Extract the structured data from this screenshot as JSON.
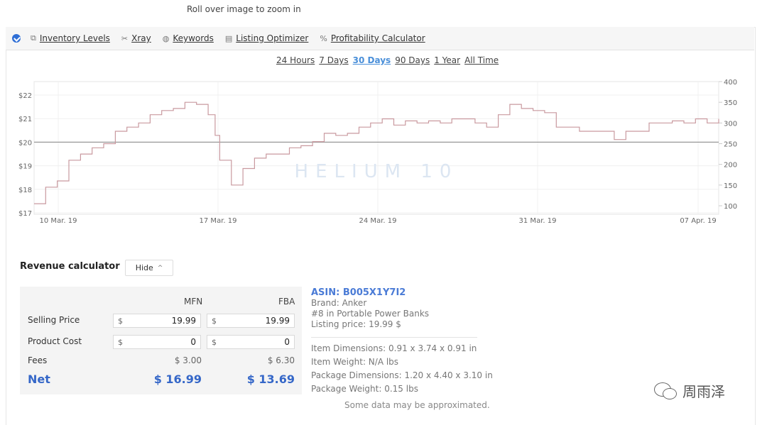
{
  "zoom_hint": "Roll over image to zoom in",
  "toolbar": {
    "items": [
      {
        "icon": "boxes-icon",
        "glyph": "⧉",
        "label": "Inventory Levels"
      },
      {
        "icon": "xray-icon",
        "glyph": "✂",
        "label": "Xray"
      },
      {
        "icon": "keywords-icon",
        "glyph": "◍",
        "label": "Keywords"
      },
      {
        "icon": "listing-icon",
        "glyph": "▤",
        "label": "Listing Optimizer"
      },
      {
        "icon": "percent-icon",
        "glyph": "%",
        "label": "Profitability Calculator"
      }
    ]
  },
  "time_ranges": {
    "options": [
      "24 Hours",
      "7 Days",
      "30 Days",
      "90 Days",
      "1 Year",
      "All Time"
    ],
    "active": "30 Days"
  },
  "chart_data": {
    "type": "line",
    "x_labels": [
      "10 Mar. 19",
      "17 Mar. 19",
      "24 Mar. 19",
      "31 Mar. 19",
      "07 Apr. 19"
    ],
    "y_left_ticks": [
      "$22",
      "$21",
      "$20",
      "$19",
      "$18",
      "$17"
    ],
    "y_right_ticks": [
      "400",
      "350",
      "300",
      "250",
      "200",
      "150",
      "100"
    ],
    "y_left_range": [
      17,
      22
    ],
    "y_right_range": [
      100,
      400
    ],
    "reference_line": 20,
    "series": [
      {
        "axis": "right",
        "color": "#c9999f",
        "x": [
          0,
          0.5,
          1,
          1.5,
          2,
          2.5,
          3,
          3.5,
          4,
          4.5,
          5,
          5.5,
          6,
          6.5,
          7,
          7.5,
          7.8,
          8,
          8.5,
          9,
          9.5,
          10,
          10.5,
          11,
          11.5,
          12,
          12.5,
          13,
          13.5,
          14,
          14.5,
          15,
          15.5,
          16,
          16.5,
          17,
          17.5,
          18,
          18.5,
          19,
          19.5,
          20,
          20.5,
          21,
          21.5,
          22,
          22.5,
          23,
          23.5,
          24,
          24.5,
          25,
          25.5,
          26,
          26.5,
          27,
          27.5,
          28,
          28.5,
          29,
          29.5
        ],
        "values": [
          105,
          145,
          160,
          210,
          225,
          240,
          250,
          280,
          290,
          300,
          320,
          330,
          335,
          350,
          345,
          320,
          270,
          210,
          150,
          190,
          215,
          225,
          225,
          240,
          245,
          255,
          275,
          270,
          275,
          290,
          300,
          310,
          295,
          305,
          300,
          305,
          300,
          310,
          310,
          300,
          290,
          320,
          345,
          335,
          330,
          325,
          290,
          290,
          280,
          280,
          280,
          260,
          280,
          280,
          300,
          300,
          305,
          300,
          310,
          300,
          310
        ]
      }
    ]
  },
  "revenue": {
    "title": "Revenue calculator",
    "hide_label": "Hide",
    "col_mfn": "MFN",
    "col_fba": "FBA",
    "selling_price_label": "Selling Price",
    "product_cost_label": "Product Cost",
    "fees_label": "Fees",
    "net_label": "Net",
    "currency": "$",
    "mfn": {
      "selling_price": "19.99",
      "product_cost": "0",
      "fees": "$ 3.00",
      "net": "$ 16.99"
    },
    "fba": {
      "selling_price": "19.99",
      "product_cost": "0",
      "fees": "$ 6.30",
      "net": "$ 13.69"
    }
  },
  "product": {
    "asin": "ASIN: B005X1Y7I2",
    "brand": "Brand: Anker",
    "rank": "#8 in Portable Power Banks",
    "listing_price": "Listing price: 19.99 $",
    "item_dimensions": "Item Dimensions: 0.91 x 3.74 x 0.91 in",
    "item_weight": "Item Weight: N/A lbs",
    "package_dimensions": "Package Dimensions: 1.20 x 4.40 x 3.10 in",
    "package_weight": "Package Weight: 0.15 lbs"
  },
  "approx_note": "Some data may be approximated.",
  "watermark_text": "周雨泽",
  "chart_watermark": "HELIUM 10"
}
